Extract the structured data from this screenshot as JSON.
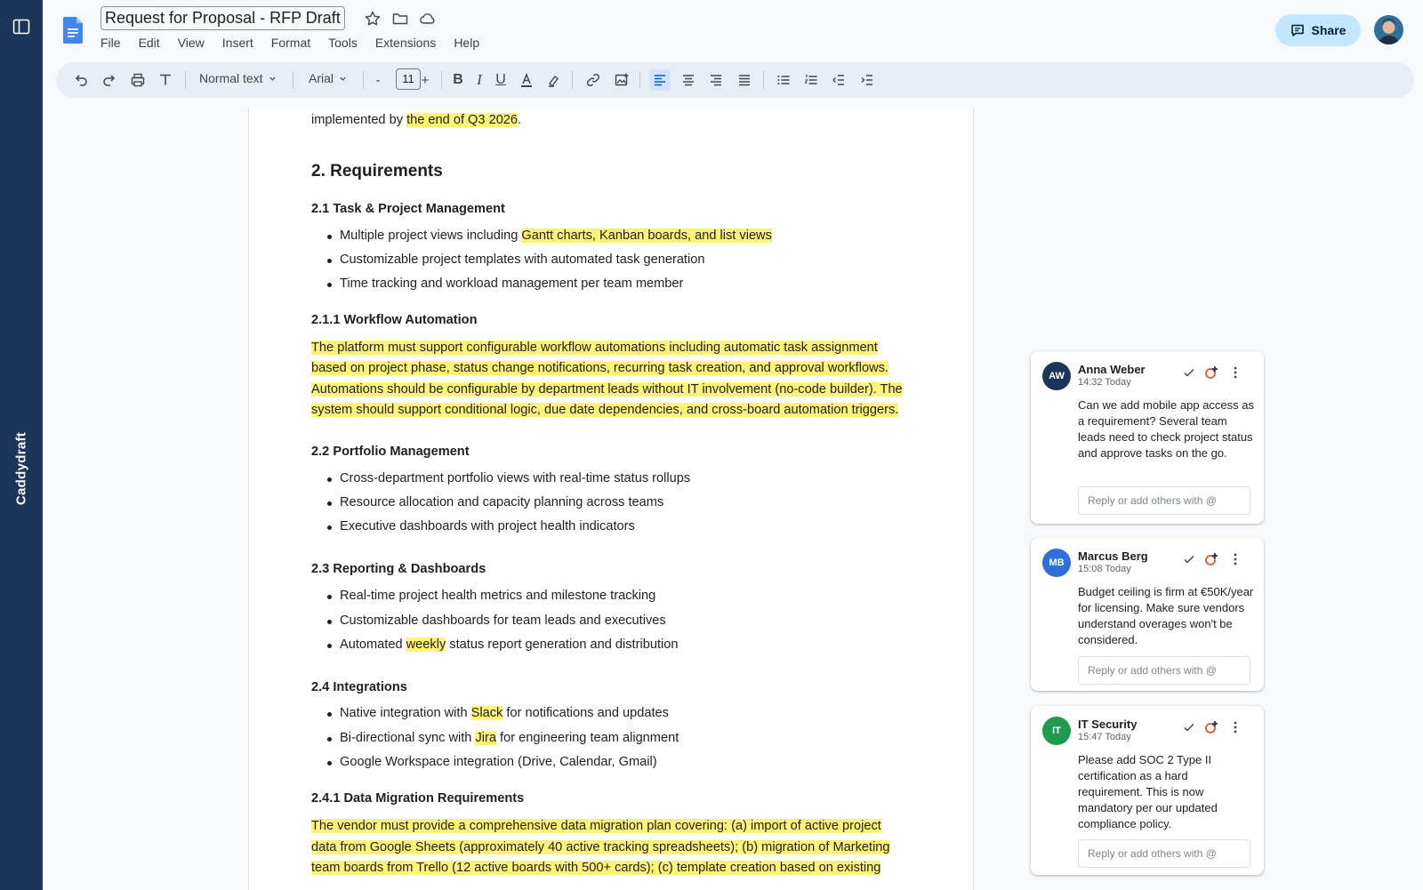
{
  "sidebar": {
    "brand": "Caddydraft",
    "toggle_icon": "sidebar-toggle-icon"
  },
  "header": {
    "doc_title": "Request for Proposal - RFP Draft",
    "menu": [
      "File",
      "Edit",
      "View",
      "Insert",
      "Format",
      "Tools",
      "Extensions",
      "Help"
    ],
    "share_label": "Share"
  },
  "toolbar": {
    "style_select": "Normal text",
    "font_select": "Arial",
    "font_size": "11",
    "decrease": "-",
    "increase": "+"
  },
  "document": {
    "intro_line": "implemented by ",
    "intro_highlight": "the end of Q3 2026",
    "intro_end": ".",
    "h_requirements": "2. Requirements",
    "h_task": "2.1 Task & Project Management",
    "task_b1_pre": "Multiple project views including ",
    "task_b1_hl": "Gantt charts, Kanban boards, and list views",
    "task_b2": "Customizable project templates with automated task generation",
    "task_b3": "Time tracking and workload management per team member",
    "h_workflow": "2.1.1 Workflow Automation",
    "workflow_p": [
      "The platform must support configurable workflow automations including automatic task assignment",
      "based on project phase, status change notifications, recurring task creation, and approval workflows.",
      "Automations should be configurable by department leads without IT involvement (no-code builder). The",
      "system should support conditional logic, due date dependencies, and cross-board automation triggers."
    ],
    "h_portfolio": "2.2 Portfolio Management",
    "portfolio_b": [
      "Cross-department portfolio views with real-time status rollups",
      "Resource allocation and capacity planning across teams",
      "Executive dashboards with project health indicators"
    ],
    "h_reporting": "2.3 Reporting & Dashboards",
    "reporting_b1": "Real-time project health metrics and milestone tracking",
    "reporting_b2": "Customizable dashboards for team leads and executives",
    "reporting_b3_pre": "Automated ",
    "reporting_b3_hl": "weekly",
    "reporting_b3_post": " status report generation and distribution",
    "h_integrations": "2.4 Integrations",
    "int_b1_pre": "Native integration with ",
    "int_b1_hl": "Slack",
    "int_b1_post": " for notifications and updates",
    "int_b2_pre": "Bi-directional sync with ",
    "int_b2_hl": "Jira",
    "int_b2_post": " for engineering team alignment",
    "int_b3": "Google Workspace integration (Drive, Calendar, Gmail)",
    "h_migration": "2.4.1 Data Migration Requirements",
    "migration_p": [
      "The vendor must provide a comprehensive data migration plan covering: (a) import of active project",
      "data from Google Sheets (approximately 40 active tracking spreadsheets); (b) migration of Marketing",
      "team boards from Trello (12 active boards with 500+ cards); (c) template creation based on existing"
    ]
  },
  "comments": [
    {
      "initials": "AW",
      "name": "Anna Weber",
      "time": "14:32 Today",
      "color": "#1b3658",
      "body": "Can we add mobile app access as a requirement? Several team leads need to check project status and approve tasks on the go.",
      "reply_placeholder": "Reply or add others with @"
    },
    {
      "initials": "MB",
      "name": "Marcus Berg",
      "time": "15:08 Today",
      "color": "#2f6fd8",
      "body": "Budget ceiling is firm at €50K/year for licensing. Make sure vendors understand overages won't be considered.",
      "reply_placeholder": "Reply or add others with @"
    },
    {
      "initials": "IT",
      "name": "IT Security",
      "time": "15:47 Today",
      "color": "#1e9b4f",
      "body": "Please add SOC 2 Type II certification as a hard requirement. This is now mandatory per our updated compliance policy.",
      "reply_placeholder": "Reply or add others with @"
    }
  ]
}
